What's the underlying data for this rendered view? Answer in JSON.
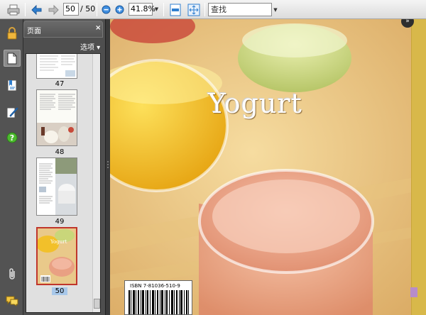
{
  "toolbar": {
    "current_page": "50",
    "total_pages": "/ 50",
    "zoom": "41.8%",
    "search_placeholder": "查找"
  },
  "panel": {
    "title": "页面",
    "close_symbol": "×",
    "options_label": "选项 ▾",
    "thumbnails": [
      {
        "label": "47"
      },
      {
        "label": "48"
      },
      {
        "label": "49"
      },
      {
        "label": "50"
      }
    ]
  },
  "document": {
    "cover_title": "Yogurt",
    "isbn": "ISBN 7-81036-510-9",
    "corner_symbol": "»"
  },
  "colors": {
    "accent_blue": "#2f7fd0",
    "selected_thumb": "#a8c8ea",
    "panel_bg": "#4e4e4e"
  }
}
